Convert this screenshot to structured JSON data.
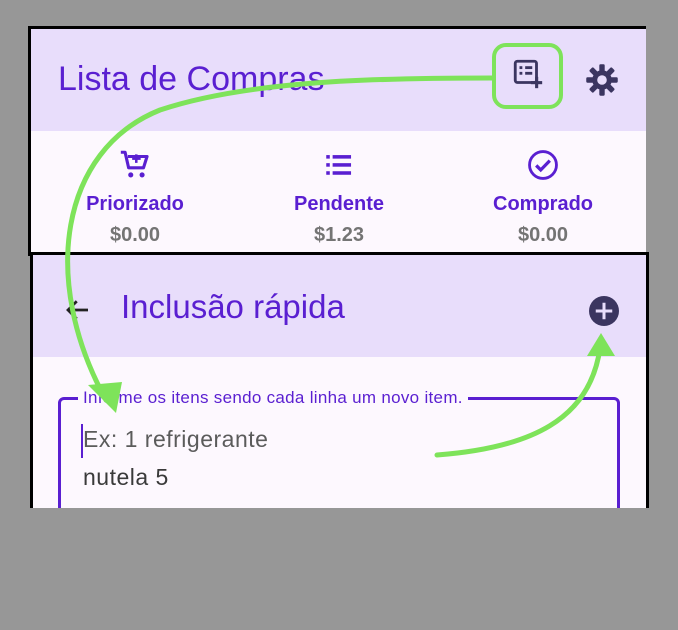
{
  "main_screen": {
    "title": "Lista de Compras",
    "actions": {
      "add_list_icon": "note-add-icon",
      "settings_icon": "gear-icon"
    },
    "tabs": [
      {
        "icon": "cart-icon",
        "label": "Priorizado",
        "value": "$0.00"
      },
      {
        "icon": "list-icon",
        "label": "Pendente",
        "value": "$1.23"
      },
      {
        "icon": "check-circle-icon",
        "label": "Comprado",
        "value": "$0.00"
      }
    ]
  },
  "quick_add": {
    "title": "Inclusão rápida",
    "back_icon": "arrow-back-icon",
    "add_icon": "plus-circle-icon",
    "field_label": "Informe os itens sendo cada linha um novo item.",
    "placeholder": "Ex: 1 refrigerante",
    "placeholder_line2": "nutela 5"
  },
  "colors": {
    "primary": "#5a1fd1",
    "appbar": "#e8ddfb",
    "highlight": "#7ee35a",
    "background": "#979797"
  }
}
